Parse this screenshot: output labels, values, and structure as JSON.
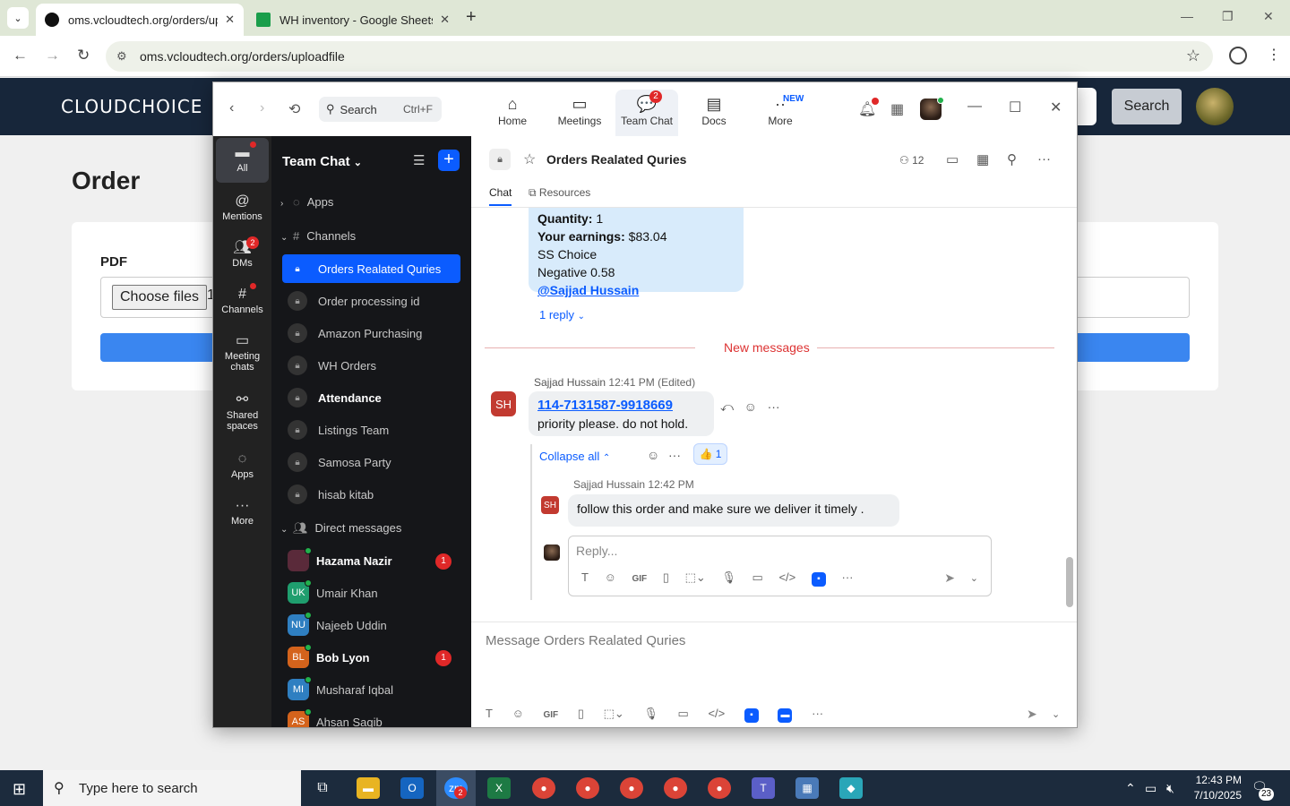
{
  "browser": {
    "tabs": [
      {
        "title": "oms.vcloudtech.org/orders/uploadfile",
        "active": true
      },
      {
        "title": "WH inventory - Google Sheets",
        "active": false
      }
    ],
    "url": "oms.vcloudtech.org/orders/uploadfile"
  },
  "site": {
    "logo": "CLOUDCHOICE",
    "search_button": "Search",
    "page_title": "Order",
    "pdf_label": "PDF",
    "choose_files": "Choose files",
    "file_count": "1"
  },
  "zoom": {
    "search_placeholder": "Search",
    "search_shortcut": "Ctrl+F",
    "nav": [
      {
        "label": "Home",
        "icon": "home-icon"
      },
      {
        "label": "Meetings",
        "icon": "video-icon"
      },
      {
        "label": "Team Chat",
        "icon": "chat-icon",
        "badge": "2"
      },
      {
        "label": "Docs",
        "icon": "doc-icon"
      },
      {
        "label": "More",
        "icon": "more-icon",
        "badge": "NEW"
      }
    ],
    "rail": [
      {
        "label": "All",
        "icon": "chat-bubble-icon"
      },
      {
        "label": "Mentions",
        "icon": "at-icon"
      },
      {
        "label": "DMs",
        "icon": "people-icon",
        "badge": "2"
      },
      {
        "label": "Channels",
        "icon": "hash-icon"
      },
      {
        "label": "Meeting chats",
        "icon": "calendar-icon"
      },
      {
        "label": "Shared spaces",
        "icon": "share-icon"
      },
      {
        "label": "Apps",
        "icon": "apps-icon"
      },
      {
        "label": "More",
        "icon": "ellipsis-icon"
      }
    ],
    "sidebar": {
      "title": "Team Chat",
      "apps_section": "Apps",
      "channels_section": "Channels",
      "channels": [
        {
          "name": "Orders Realated Quries",
          "selected": true,
          "bold": false
        },
        {
          "name": "Order processing id",
          "selected": false,
          "bold": false
        },
        {
          "name": "Amazon Purchasing",
          "selected": false,
          "bold": false
        },
        {
          "name": "WH Orders",
          "selected": false,
          "bold": false
        },
        {
          "name": "Attendance",
          "selected": false,
          "bold": true
        },
        {
          "name": "Listings Team",
          "selected": false,
          "bold": false
        },
        {
          "name": "Samosa Party",
          "selected": false,
          "bold": false
        },
        {
          "name": "hisab kitab",
          "selected": false,
          "bold": false
        }
      ],
      "dm_section": "Direct messages",
      "dms": [
        {
          "name": "Hazama Nazir",
          "initials": "",
          "color": "#5a2a3a",
          "bold": true,
          "badge": "1"
        },
        {
          "name": "Umair Khan",
          "initials": "UK",
          "color": "#1f9e6e",
          "bold": false,
          "badge": ""
        },
        {
          "name": "Najeeb Uddin",
          "initials": "NU",
          "color": "#2f7fc1",
          "bold": false,
          "badge": ""
        },
        {
          "name": "Bob Lyon",
          "initials": "BL",
          "color": "#d4631c",
          "bold": true,
          "badge": "1"
        },
        {
          "name": "Musharaf Iqbal",
          "initials": "MI",
          "color": "#2f7fc1",
          "bold": false,
          "badge": ""
        },
        {
          "name": "Ahsan Saqib",
          "initials": "AS",
          "color": "#d4631c",
          "bold": false,
          "badge": ""
        }
      ]
    },
    "channel": {
      "name": "Orders Realated Quries",
      "member_count": "12",
      "tab_chat": "Chat",
      "tab_resources": "Resources"
    },
    "prev_message": {
      "quantity_label": "Quantity:",
      "quantity_value": " 1",
      "earnings_label": "Your earnings:",
      "earnings_value": " $83.04",
      "line3": "SS Choice",
      "line4": "Negative 0.58",
      "mention": "@Sajjad Hussain",
      "reply_link": "1 reply"
    },
    "new_messages_label": "New messages",
    "message": {
      "avatar": "SH",
      "sender": "Sajjad Hussain",
      "time": "12:41 PM (Edited)",
      "order_id": "114-7131587-9918669",
      "text": "priority please. do not hold.",
      "collapse": "Collapse all",
      "reaction": "👍 1"
    },
    "reply": {
      "avatar": "SH",
      "sender": "Sajjad Hussain",
      "time": "12:42 PM",
      "text": "follow this order and make sure we deliver it timely ."
    },
    "reply_placeholder": "Reply...",
    "composer_placeholder": "Message Orders Realated Quries"
  },
  "taskbar": {
    "search_placeholder": "Type here to search",
    "time": "12:43 PM",
    "date": "7/10/2025",
    "notification_count": "23",
    "zoom_badge": "2"
  }
}
